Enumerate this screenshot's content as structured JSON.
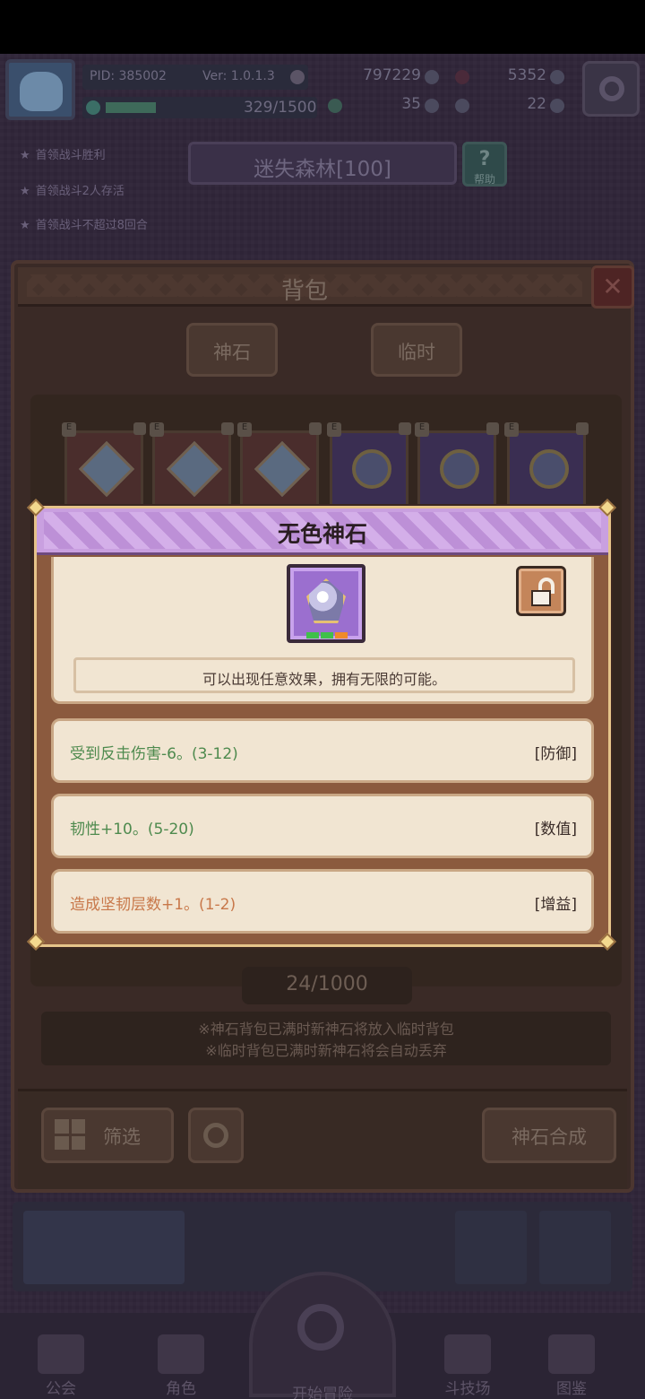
{
  "topbar": {
    "pid": "PID: 385002",
    "version": "Ver: 1.0.1.3",
    "exp": "329/1500",
    "gold": "797229",
    "gems": "5352",
    "clover": "35",
    "puzzle": "22"
  },
  "quests": [
    "首领战斗胜利",
    "首领战斗2人存活",
    "首领战斗不超过8回合"
  ],
  "stage": {
    "name": "迷失森林[100]",
    "help_label": "帮助",
    "help_mark": "?"
  },
  "bag": {
    "title": "背包",
    "close_glyph": "✕",
    "tabs": [
      "神石",
      "临时"
    ],
    "count": "24/1000",
    "notices": [
      "※神石背包已满时新神石将放入临时背包",
      "※临时背包已满时新神石将会自动丢弃"
    ],
    "filter_label": "筛选",
    "merge_label": "神石合成",
    "slot_e": "E"
  },
  "modal": {
    "title": "无色神石",
    "description": "可以出现任意效果，拥有无限的可能。",
    "effects": [
      {
        "text": "受到反击伤害-6。(3-12)",
        "tag": "[防御]",
        "color": "green"
      },
      {
        "text": "韧性+10。(5-20)",
        "tag": "[数值]",
        "color": "green"
      },
      {
        "text": "造成坚韧层数+1。(1-2)",
        "tag": "[增益]",
        "color": "orange"
      }
    ],
    "pip_colors": [
      "#3fc04a",
      "#3fc04a",
      "#f08a2a"
    ]
  },
  "nav": [
    "公会",
    "角色",
    "开始冒险",
    "斗技场",
    "图鉴"
  ],
  "colors": {
    "accent_purple": "#c9a0e0",
    "card_bg": "#f1e5d2",
    "frame": "#8b5a3e",
    "green_text": "#4e8a4e",
    "orange_text": "#c8784a"
  }
}
